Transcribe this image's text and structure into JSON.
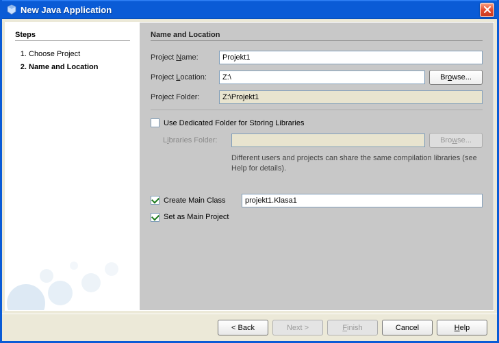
{
  "titlebar": {
    "title": "New Java Application"
  },
  "sidebar": {
    "heading": "Steps",
    "steps": [
      "Choose Project",
      "Name and Location"
    ],
    "current_index": 1
  },
  "content": {
    "heading": "Name and Location",
    "project_name_label": "Project Name:",
    "project_name_value": "Projekt1",
    "project_location_label": "Project Location:",
    "project_location_value": "Z:\\",
    "browse_label": "Browse...",
    "project_folder_label": "Project Folder:",
    "project_folder_value": "Z:\\Projekt1",
    "dedicated_label": "Use Dedicated Folder for Storing Libraries",
    "dedicated_checked": false,
    "libraries_label": "Libraries Folder:",
    "libraries_value": "",
    "libraries_browse_label": "Browse...",
    "libraries_help": "Different users and projects can share the same compilation libraries (see Help for details).",
    "create_main_label": "Create Main Class",
    "create_main_checked": true,
    "main_class_value": "projekt1.Klasa1",
    "set_main_label": "Set as Main Project",
    "set_main_checked": true
  },
  "footer": {
    "back": "< Back",
    "next": "Next >",
    "finish": "Finish",
    "cancel": "Cancel",
    "help": "Help"
  }
}
